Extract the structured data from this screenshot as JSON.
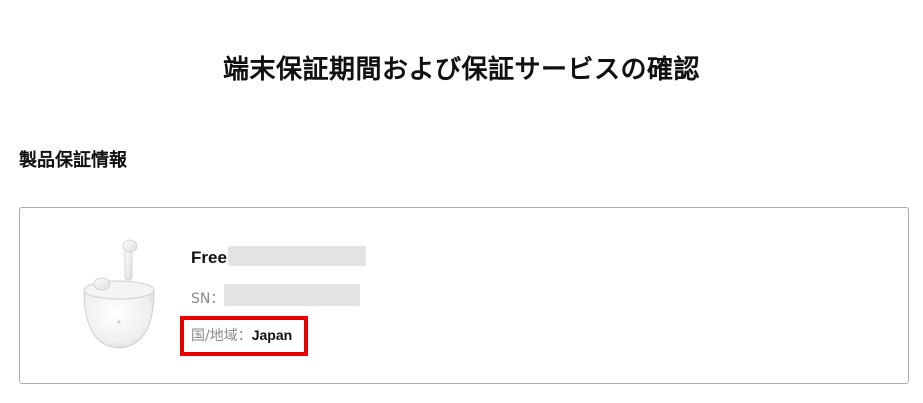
{
  "page": {
    "title": "端末保証期間および保証サービスの確認"
  },
  "section": {
    "title": "製品保証情報"
  },
  "product": {
    "image_icon": "earbuds-case-image",
    "name_visible": "Free",
    "sn_label": "SN：",
    "region_label": "国/地域：",
    "region_value": "Japan"
  },
  "colors": {
    "highlight": "#e60000",
    "card_border": "#a9a9a9",
    "muted_text": "#8a8a8a"
  }
}
